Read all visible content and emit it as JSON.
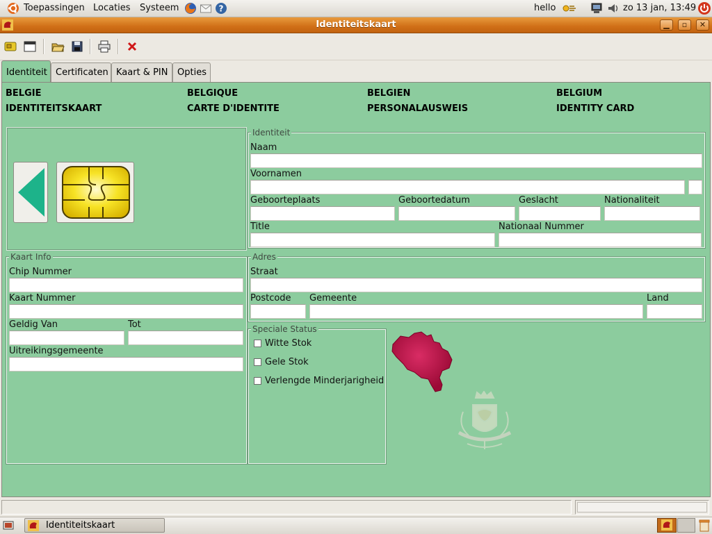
{
  "top_panel": {
    "menus": [
      "Toepassingen",
      "Locaties",
      "Systeem"
    ],
    "username": "hello",
    "clock": "zo 13 jan, 13:49",
    "icons": [
      "ubuntu-logo-icon",
      "firefox-icon",
      "mail-icon",
      "help-icon",
      "network-icon",
      "computer-icon",
      "volume-icon",
      "power-icon"
    ]
  },
  "window": {
    "title": "Identiteitskaart"
  },
  "toolbar": {
    "buttons": [
      "read-card-icon",
      "window-icon",
      "open-folder-icon",
      "save-icon",
      "print-icon",
      "close-red-icon"
    ]
  },
  "tabs": [
    "Identiteit",
    "Certificaten",
    "Kaart & PIN",
    "Opties"
  ],
  "card_header": {
    "countries": [
      "BELGIE",
      "BELGIQUE",
      "BELGIEN",
      "BELGIUM"
    ],
    "titles": [
      "IDENTITEITSKAART",
      "CARTE D'IDENTITE",
      "PERSONALAUSWEIS",
      "IDENTITY CARD"
    ]
  },
  "identiteit": {
    "title": "Identiteit",
    "naam_label": "Naam",
    "voornamen_label": "Voornamen",
    "geboorteplaats_label": "Geboorteplaats",
    "geboortedatum_label": "Geboortedatum",
    "geslacht_label": "Geslacht",
    "nationaliteit_label": "Nationaliteit",
    "title_label": "Title",
    "nationaal_nummer_label": "Nationaal Nummer",
    "values": {
      "naam": "",
      "voornamen": "",
      "initial": "",
      "geboorteplaats": "",
      "geboortedatum": "",
      "geslacht": "",
      "nationaliteit": "",
      "title": "",
      "nationaal_nummer": ""
    }
  },
  "kaart_info": {
    "title": "Kaart Info",
    "chip_label": "Chip Nummer",
    "kaart_label": "Kaart Nummer",
    "geldig_van_label": "Geldig Van",
    "tot_label": "Tot",
    "uitreikingsgemeente_label": "Uitreikingsgemeente",
    "values": {
      "chip": "",
      "kaart": "",
      "geldig_van": "",
      "tot": "",
      "uitreikingsgemeente": ""
    }
  },
  "adres": {
    "title": "Adres",
    "straat_label": "Straat",
    "postcode_label": "Postcode",
    "gemeente_label": "Gemeente",
    "land_label": "Land",
    "values": {
      "straat": "",
      "postcode": "",
      "gemeente": "",
      "land": ""
    }
  },
  "speciale_status": {
    "title": "Speciale Status",
    "options": [
      {
        "label": "Witte Stok",
        "checked": false
      },
      {
        "label": "Gele Stok",
        "checked": false
      },
      {
        "label": "Verlengde Minderjarigheid",
        "checked": false
      }
    ]
  },
  "taskbar": {
    "item": "Identiteitskaart"
  },
  "colors": {
    "card_bg": "#8ccc9e",
    "titlebar": "#d06f17",
    "belgium_map": "#b0103f",
    "arrow": "#1db38a",
    "chip": "#f5e31a"
  }
}
